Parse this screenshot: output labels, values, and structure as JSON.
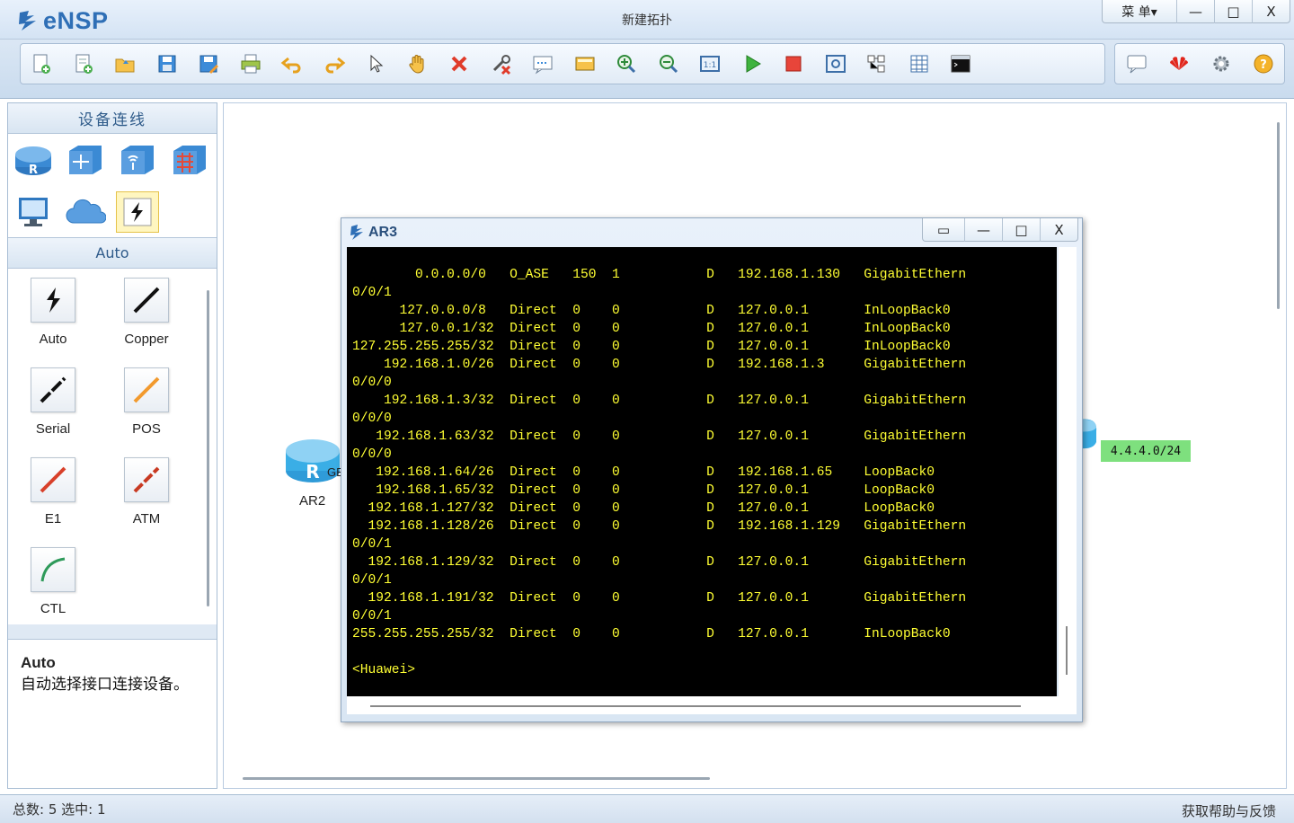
{
  "app": {
    "name": "eNSP",
    "window_title": "新建拓扑",
    "menu_label": "菜 单▾",
    "minimize": "—",
    "maximize": "□",
    "close": "X"
  },
  "toolbar": {
    "items": [
      "new-topology",
      "new-exam",
      "open",
      "save",
      "save-as",
      "print",
      "undo",
      "redo",
      "select",
      "pan",
      "delete",
      "delete-link",
      "text",
      "palette",
      "zoom-in",
      "zoom-out",
      "fit",
      "start",
      "stop",
      "capture",
      "topo",
      "grid",
      "console"
    ],
    "right_items": [
      "chat",
      "huawei",
      "settings",
      "help"
    ]
  },
  "left_panel": {
    "header": "设备连线",
    "devices": [
      "router",
      "switch",
      "wireless",
      "firewall",
      "pc",
      "cloud",
      "auto-link"
    ],
    "sub_header": "Auto",
    "cables": [
      {
        "label": "Auto",
        "color": "#222222"
      },
      {
        "label": "Copper",
        "color": "#111111"
      },
      {
        "label": "Serial",
        "color": "#111111"
      },
      {
        "label": "POS",
        "color": "#f29a2e"
      },
      {
        "label": "E1",
        "color": "#d8402a"
      },
      {
        "label": "ATM",
        "color": "#c83a22"
      },
      {
        "label": "CTL",
        "color": "#2e9a5a"
      }
    ],
    "desc_title": "Auto",
    "desc_text": "自动选择接口连接设备。"
  },
  "canvas": {
    "router_label": "AR2",
    "port_label": "GE",
    "network_label": "4.4.4.0/24"
  },
  "terminal": {
    "title": "AR3",
    "ctl_extra": "▭",
    "lines": [
      "        0.0.0.0/0   O_ASE   150  1           D   192.168.1.130   GigabitEthern",
      "0/0/1",
      "      127.0.0.0/8   Direct  0    0           D   127.0.0.1       InLoopBack0",
      "      127.0.0.1/32  Direct  0    0           D   127.0.0.1       InLoopBack0",
      "127.255.255.255/32  Direct  0    0           D   127.0.0.1       InLoopBack0",
      "    192.168.1.0/26  Direct  0    0           D   192.168.1.3     GigabitEthern",
      "0/0/0",
      "    192.168.1.3/32  Direct  0    0           D   127.0.0.1       GigabitEthern",
      "0/0/0",
      "   192.168.1.63/32  Direct  0    0           D   127.0.0.1       GigabitEthern",
      "0/0/0",
      "   192.168.1.64/26  Direct  0    0           D   192.168.1.65    LoopBack0",
      "   192.168.1.65/32  Direct  0    0           D   127.0.0.1       LoopBack0",
      "  192.168.1.127/32  Direct  0    0           D   127.0.0.1       LoopBack0",
      "  192.168.1.128/26  Direct  0    0           D   192.168.1.129   GigabitEthern",
      "0/0/1",
      "  192.168.1.129/32  Direct  0    0           D   127.0.0.1       GigabitEthern",
      "0/0/1",
      "  192.168.1.191/32  Direct  0    0           D   127.0.0.1       GigabitEthern",
      "0/0/1",
      "255.255.255.255/32  Direct  0    0           D   127.0.0.1       InLoopBack0",
      "",
      "<Huawei>"
    ]
  },
  "status": {
    "left": "总数: 5  选中: 1",
    "right": "获取帮助与反馈"
  },
  "colors": {
    "accent": "#2f6fb6",
    "terminal_text": "#ffff33",
    "terminal_bg": "#000000",
    "network_label_bg": "#7ee07e"
  }
}
